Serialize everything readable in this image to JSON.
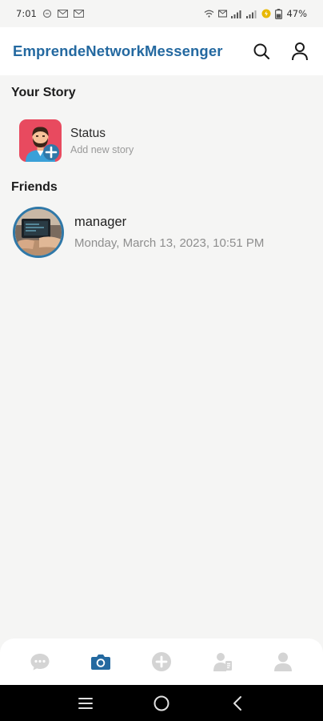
{
  "status_bar": {
    "time": "7:01",
    "battery": "47%"
  },
  "app_bar": {
    "title": "EmprendeNetworkMessenger",
    "icons": [
      "search-icon",
      "profile-icon"
    ]
  },
  "your_story": {
    "heading": "Your Story",
    "item": {
      "name": "Status",
      "subtitle": "Add new story"
    }
  },
  "friends": {
    "heading": "Friends",
    "items": [
      {
        "name": "manager",
        "timestamp": "Monday, March 13, 2023, 10:51 PM"
      }
    ]
  },
  "bottom_nav": {
    "items": [
      "chat-icon",
      "camera-icon",
      "add-icon",
      "contacts-icon",
      "profile-icon"
    ],
    "active": "camera-icon"
  },
  "colors": {
    "brand": "#2469a0",
    "active_nav": "#2469a0",
    "inactive_nav": "#d6d6d6",
    "background": "#f5f5f4"
  }
}
